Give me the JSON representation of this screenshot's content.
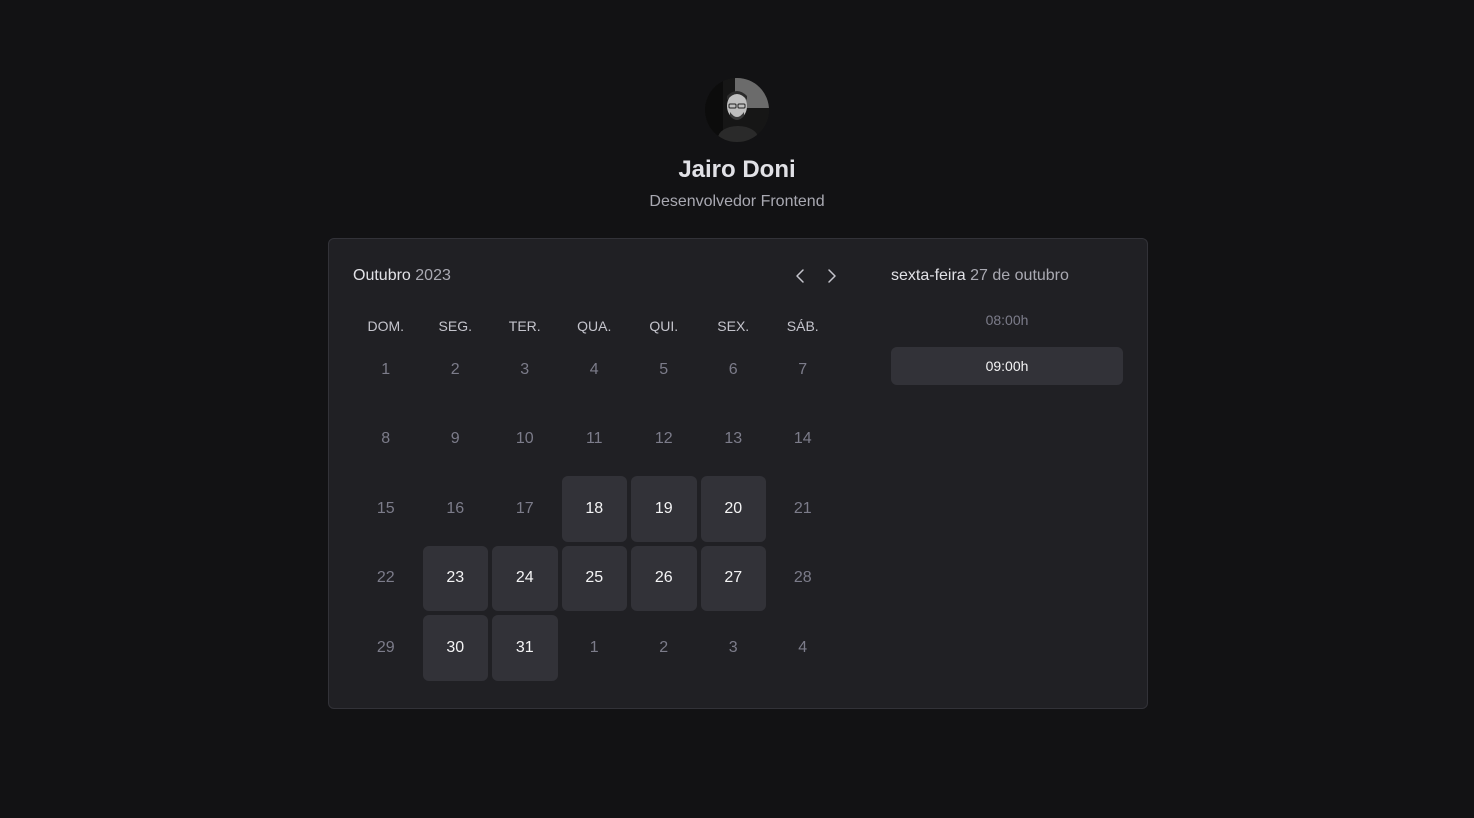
{
  "profile": {
    "name": "Jairo Doni",
    "role": "Desenvolvedor Frontend"
  },
  "calendar": {
    "month": "Outubro",
    "year": "2023",
    "weekdays": [
      "DOM.",
      "SEG.",
      "TER.",
      "QUA.",
      "QUI.",
      "SEX.",
      "SÁB."
    ],
    "days": [
      {
        "label": "1",
        "available": false
      },
      {
        "label": "2",
        "available": false
      },
      {
        "label": "3",
        "available": false
      },
      {
        "label": "4",
        "available": false
      },
      {
        "label": "5",
        "available": false
      },
      {
        "label": "6",
        "available": false
      },
      {
        "label": "7",
        "available": false
      },
      {
        "label": "8",
        "available": false
      },
      {
        "label": "9",
        "available": false
      },
      {
        "label": "10",
        "available": false
      },
      {
        "label": "11",
        "available": false
      },
      {
        "label": "12",
        "available": false
      },
      {
        "label": "13",
        "available": false
      },
      {
        "label": "14",
        "available": false
      },
      {
        "label": "15",
        "available": false
      },
      {
        "label": "16",
        "available": false
      },
      {
        "label": "17",
        "available": false
      },
      {
        "label": "18",
        "available": true
      },
      {
        "label": "19",
        "available": true
      },
      {
        "label": "20",
        "available": true
      },
      {
        "label": "21",
        "available": false
      },
      {
        "label": "22",
        "available": false
      },
      {
        "label": "23",
        "available": true
      },
      {
        "label": "24",
        "available": true
      },
      {
        "label": "25",
        "available": true
      },
      {
        "label": "26",
        "available": true
      },
      {
        "label": "27",
        "available": true
      },
      {
        "label": "28",
        "available": false
      },
      {
        "label": "29",
        "available": false
      },
      {
        "label": "30",
        "available": true
      },
      {
        "label": "31",
        "available": true
      },
      {
        "label": "1",
        "available": false
      },
      {
        "label": "2",
        "available": false
      },
      {
        "label": "3",
        "available": false
      },
      {
        "label": "4",
        "available": false
      }
    ]
  },
  "schedule": {
    "weekday": "sexta-feira",
    "date": "27 de outubro",
    "times": [
      {
        "label": "08:00h",
        "available": false
      },
      {
        "label": "09:00h",
        "available": true
      }
    ]
  },
  "colors": {
    "background": "#121214",
    "card": "#202024",
    "available": "#323238",
    "muted": "#7c7c8a"
  }
}
